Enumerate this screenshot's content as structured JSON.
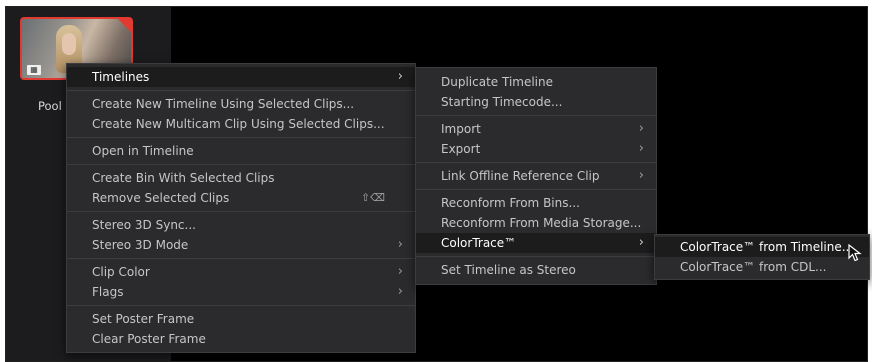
{
  "clip": {
    "name": "Pool S"
  },
  "menu_main": {
    "groups": [
      [
        {
          "label": "Timelines",
          "submenu": true,
          "highlighted": true
        }
      ],
      [
        {
          "label": "Create New Timeline Using Selected Clips..."
        },
        {
          "label": "Create New Multicam Clip Using Selected Clips..."
        }
      ],
      [
        {
          "label": "Open in Timeline"
        }
      ],
      [
        {
          "label": "Create Bin With Selected Clips"
        },
        {
          "label": "Remove Selected Clips",
          "shortcut": "⇧⌫"
        }
      ],
      [
        {
          "label": "Stereo 3D Sync..."
        },
        {
          "label": "Stereo 3D Mode",
          "submenu": true
        }
      ],
      [
        {
          "label": "Clip Color",
          "submenu": true
        },
        {
          "label": "Flags",
          "submenu": true
        }
      ],
      [
        {
          "label": "Set Poster Frame"
        },
        {
          "label": "Clear Poster Frame"
        }
      ]
    ]
  },
  "menu_timelines": {
    "groups": [
      [
        {
          "label": "Duplicate Timeline"
        },
        {
          "label": "Starting Timecode..."
        }
      ],
      [
        {
          "label": "Import",
          "submenu": true
        },
        {
          "label": "Export",
          "submenu": true
        }
      ],
      [
        {
          "label": "Link Offline Reference Clip",
          "submenu": true
        }
      ],
      [
        {
          "label": "Reconform From Bins..."
        },
        {
          "label": "Reconform From Media Storage..."
        },
        {
          "label": "ColorTrace™",
          "submenu": true,
          "highlighted": true
        }
      ],
      [
        {
          "label": "Set Timeline as Stereo"
        }
      ]
    ]
  },
  "menu_colortrace": {
    "groups": [
      [
        {
          "label": "ColorTrace™ from Timeline...",
          "highlighted": true
        },
        {
          "label": "ColorTrace™ from CDL..."
        }
      ]
    ]
  },
  "icons": {
    "submenu_arrow": "›",
    "clip_badge": "▦"
  },
  "colors": {
    "accent_red": "#e03a31",
    "menu_bg": "#2b2b2d",
    "highlight_bg": "#1c1c1c"
  }
}
